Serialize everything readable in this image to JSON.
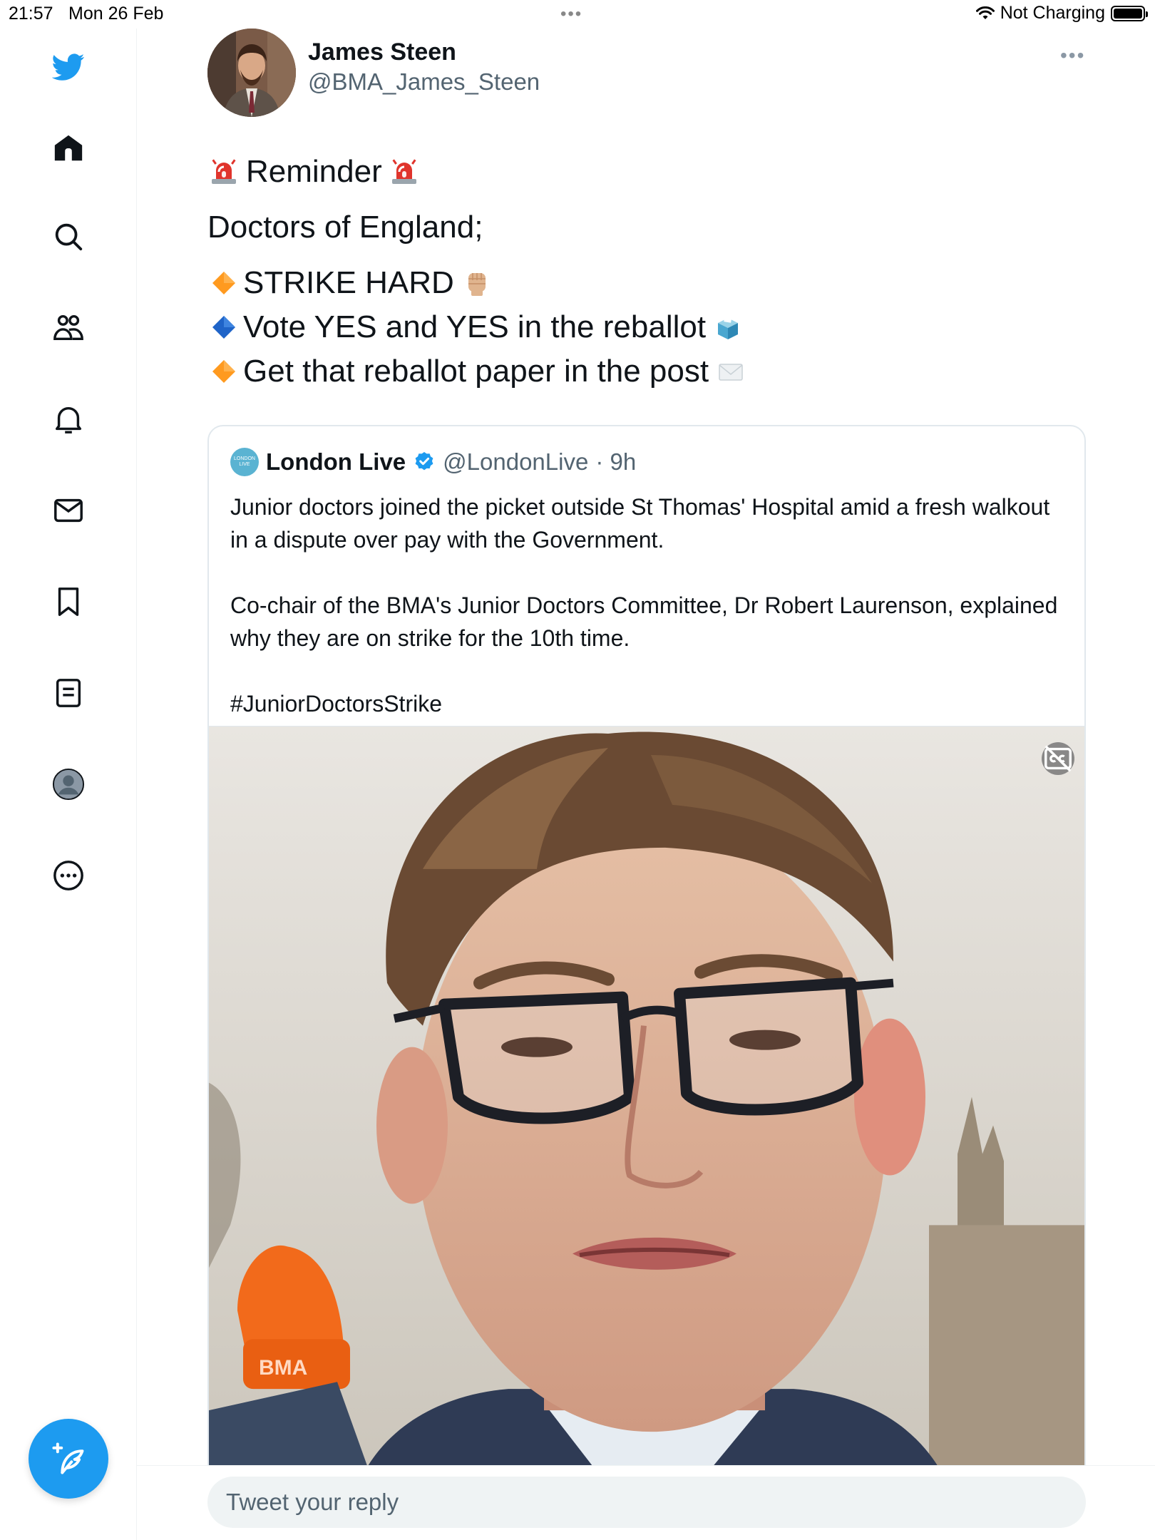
{
  "status_bar": {
    "time": "21:57",
    "date": "Mon 26 Feb",
    "charging": "Not Charging"
  },
  "sidebar": {
    "items": [
      {
        "icon": "twitter-bird-icon"
      },
      {
        "icon": "home-icon"
      },
      {
        "icon": "search-icon"
      },
      {
        "icon": "communities-icon"
      },
      {
        "icon": "notifications-icon"
      },
      {
        "icon": "messages-icon"
      },
      {
        "icon": "bookmarks-icon"
      },
      {
        "icon": "lists-icon"
      },
      {
        "icon": "profile-icon"
      },
      {
        "icon": "more-icon"
      }
    ],
    "compose_icon": "compose-tweet-icon"
  },
  "tweet": {
    "author_name": "James Steen",
    "author_handle": "@BMA_James_Steen",
    "lines": {
      "reminder": "Reminder",
      "doctors": "Doctors of England;",
      "strike": "STRIKE HARD",
      "vote": "Vote YES and YES in the reballot",
      "post": "Get that reballot paper in the post"
    }
  },
  "quoted_tweet": {
    "name": "London Live",
    "handle": "@LondonLive",
    "time": "· 9h",
    "logo_text": "LONDON LIVE",
    "paragraph1": "Junior doctors joined the picket outside St Thomas' Hospital amid a fresh walkout in a dispute over pay with the Government.",
    "paragraph2": "Co-chair of the BMA's Junior Doctors Committee, Dr Robert Laurenson, explained why they are on strike for the 10th time.",
    "hashtag": "#JuniorDoctorsStrike",
    "media_hat_text": "BMA"
  },
  "reply": {
    "placeholder": "Tweet your reply"
  },
  "colors": {
    "accent": "#1d9bf0",
    "text_primary": "#0f1419",
    "text_secondary": "#536471",
    "border": "#e1e8ed"
  }
}
